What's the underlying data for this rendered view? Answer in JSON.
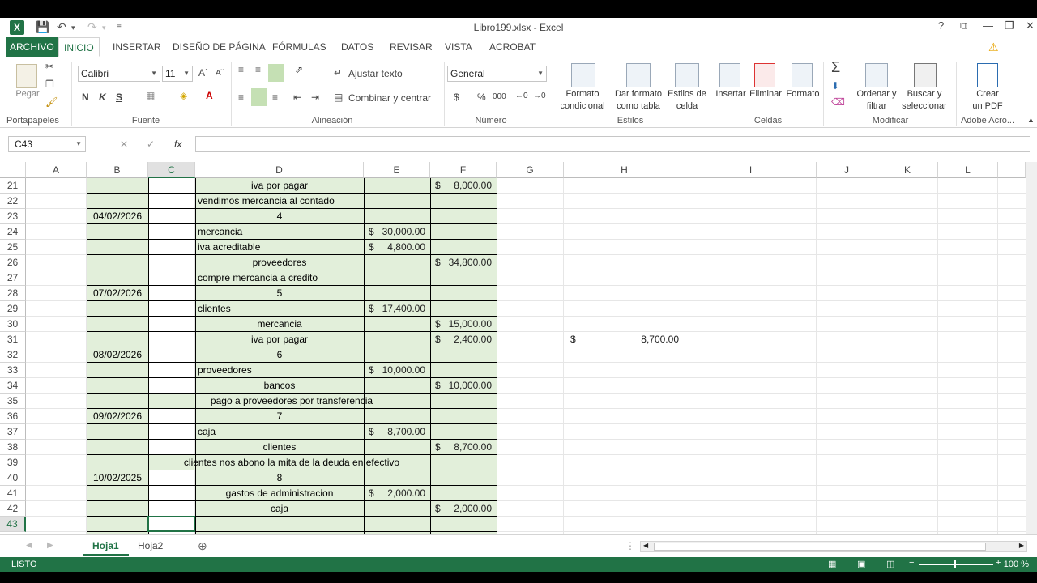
{
  "window": {
    "title": "Libro199.xlsx - Excel",
    "app_icon": "X",
    "help": "?",
    "controls": [
      "⧉",
      "—",
      "❐",
      "✕"
    ]
  },
  "menu": {
    "tabs": [
      "ARCHIVO",
      "INICIO",
      "INSERTAR",
      "DISEÑO DE PÁGINA",
      "FÓRMULAS",
      "DATOS",
      "REVISAR",
      "VISTA",
      "ACROBAT"
    ],
    "active": "INICIO"
  },
  "ribbon": {
    "clipboard": {
      "paste": "Pegar",
      "group": "Portapapeles"
    },
    "font": {
      "name": "Calibri",
      "size": "11",
      "bold": "N",
      "italic": "K",
      "underline": "S",
      "group": "Fuente"
    },
    "alignment": {
      "wrap": "Ajustar texto",
      "merge": "Combinar y centrar",
      "group": "Alineación"
    },
    "number": {
      "format": "General",
      "currency": "$",
      "percent": "%",
      "thousands": "000",
      "group": "Número"
    },
    "styles": {
      "conditional": [
        "Formato",
        "condicional"
      ],
      "table": [
        "Dar formato",
        "como tabla"
      ],
      "cell": [
        "Estilos de",
        "celda"
      ],
      "group": "Estilos"
    },
    "cells": {
      "insert": "Insertar",
      "delete": "Eliminar",
      "format": "Formato",
      "group": "Celdas"
    },
    "modify": {
      "sort": [
        "Ordenar y",
        "filtrar"
      ],
      "find": [
        "Buscar y",
        "seleccionar"
      ],
      "group": "Modificar"
    },
    "adobe": {
      "create": [
        "Crear",
        "un PDF"
      ],
      "group": "Adobe Acro..."
    }
  },
  "formula_bar": {
    "name_box": "C43",
    "fx": "fx",
    "cancel": "✕",
    "enter": "✓",
    "formula": ""
  },
  "columns": [
    "A",
    "B",
    "C",
    "D",
    "E",
    "F",
    "G",
    "H",
    "I",
    "J",
    "K",
    "L"
  ],
  "selected_column": "C",
  "rows": [
    "21",
    "22",
    "23",
    "24",
    "25",
    "26",
    "27",
    "28",
    "29",
    "30",
    "31",
    "32",
    "33",
    "34",
    "35",
    "36",
    "37",
    "38",
    "39",
    "40",
    "41",
    "42",
    "43"
  ],
  "selected_row": "43",
  "cells": {
    "D21": "iva por pagar",
    "F21": "8,000.00",
    "D22": "vendimos mercancia al contado",
    "B23": "04/02/2026",
    "D23": "4",
    "D24": "mercancia",
    "E24": "30,000.00",
    "D25": "iva acreditable",
    "E25": "4,800.00",
    "D26": "proveedores",
    "F26": "34,800.00",
    "D27": "compre mercancia a credito",
    "B28": "07/02/2026",
    "D28": "5",
    "D29": "clientes",
    "E29": "17,400.00",
    "D30": "mercancia",
    "F30": "15,000.00",
    "D31": "iva por pagar",
    "F31": "2,400.00",
    "H31": "8,700.00",
    "B32": "08/02/2026",
    "D32": "6",
    "D33": "proveedores",
    "E33": "10,000.00",
    "D34": "bancos",
    "F34": "10,000.00",
    "D35": "pago a proveedores por transferencia",
    "B36": "09/02/2026",
    "D36": "7",
    "D37": "caja",
    "E37": "8,700.00",
    "D38": "clientes",
    "F38": "8,700.00",
    "D39": "clientes nos abono la mita de la deuda en efectivo",
    "B40": "10/02/2025",
    "D40": "8",
    "D41": "gastos de administracion",
    "E41": "2,000.00",
    "D42": "caja",
    "F42": "2,000.00"
  },
  "currency_symbol": "$",
  "sheets": [
    "Hoja1",
    "Hoja2"
  ],
  "active_sheet": "Hoja1",
  "status": {
    "ready": "LISTO",
    "zoom": "100 %"
  },
  "colors": {
    "excel_green": "#217346",
    "cell_fill": "#e2efda"
  }
}
